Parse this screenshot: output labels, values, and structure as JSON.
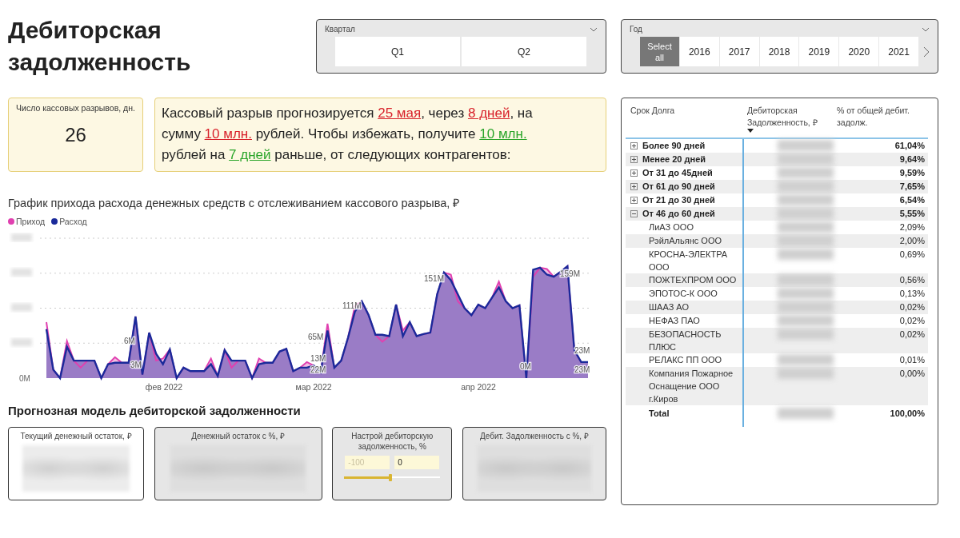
{
  "title": "Дебиторская задолженность",
  "quarter_slicer": {
    "label": "Квартал",
    "items": [
      {
        "label": "Q1",
        "selected": false
      },
      {
        "label": "Q2",
        "selected": false
      }
    ]
  },
  "year_slicer": {
    "label": "Год",
    "items": [
      {
        "label": "Select all",
        "selected": true
      },
      {
        "label": "2016",
        "selected": false
      },
      {
        "label": "2017",
        "selected": false
      },
      {
        "label": "2018",
        "selected": false
      },
      {
        "label": "2019",
        "selected": false
      },
      {
        "label": "2020",
        "selected": false
      },
      {
        "label": "2021",
        "selected": false
      }
    ]
  },
  "kpi": {
    "label": "Число кассовых разрывов, дн.",
    "value": "26"
  },
  "message": [
    {
      "text": "Кассовый разрыв прогнозируется ",
      "kind": "plain"
    },
    {
      "text": "25 мая",
      "kind": "alert"
    },
    {
      "text": ", через ",
      "kind": "plain"
    },
    {
      "text": "8 дней",
      "kind": "alert"
    },
    {
      "text": ", на сумму ",
      "kind": "plain"
    },
    {
      "text": "10 млн.",
      "kind": "alert"
    },
    {
      "text": "  рублей. Чтобы избежать, получите ",
      "kind": "plain"
    },
    {
      "text": "10 млн.",
      "kind": "good"
    },
    {
      "text": " рублей на ",
      "kind": "plain"
    },
    {
      "text": "7 дней",
      "kind": "good"
    },
    {
      "text": " раньше, от следующих контрагентов:",
      "kind": "plain"
    }
  ],
  "chart": {
    "title": "График прихода расхода денежных средств с отслеживанием кассового разрыва, ₽",
    "legend": [
      {
        "name": "Приход",
        "color": "#e040b0"
      },
      {
        "name": "Расход",
        "color": "#1a2a9a"
      }
    ],
    "y_axis_label": "0M",
    "months": [
      "фев 2022",
      "мар 2022",
      "апр 2022"
    ],
    "value_labels": [
      "6M",
      "3M",
      "65M",
      "13M",
      "22M",
      "111M",
      "151M",
      "0M",
      "159M",
      "23M",
      "23M"
    ]
  },
  "model": {
    "title": "Прогнозная модель дебиторской задолженности",
    "cards": [
      {
        "kind": "value",
        "label": "Текущий денежный остаток, ₽",
        "shaded": false
      },
      {
        "kind": "value",
        "label": "Денежный остаток с %, ₽",
        "shaded": true
      },
      {
        "kind": "slider",
        "label": "Настрой дебиторскую задолженность, %",
        "min": "-100",
        "value": "0",
        "level": 0.48,
        "shaded": true
      },
      {
        "kind": "value",
        "label": "Дебит. Задолженность с %, ₽",
        "shaded": true
      }
    ]
  },
  "table": {
    "columns": [
      "Срок Долга",
      "Дебиторская Задолженность, ₽",
      "% от общей дебит. задолж."
    ],
    "rows": [
      {
        "name": "Более 90 дней",
        "pct": "61,04%",
        "expanded": false
      },
      {
        "name": "Менее 20 дней",
        "pct": "9,64%",
        "expanded": false
      },
      {
        "name": "От 31 до 45дней",
        "pct": "9,59%",
        "expanded": false
      },
      {
        "name": "От 61 до 90 дней",
        "pct": "7,65%",
        "expanded": false
      },
      {
        "name": "От 21 до 30 дней",
        "pct": "6,54%",
        "expanded": false
      },
      {
        "name": "От 46 до 60 дней",
        "pct": "5,55%",
        "expanded": true,
        "children": [
          {
            "name": "ЛиАЗ ООО",
            "pct": "2,09%"
          },
          {
            "name": "РэйлАльянс ООО",
            "pct": "2,00%"
          },
          {
            "name": "КРОСНА-ЭЛЕКТРА ООО",
            "pct": "0,69%"
          },
          {
            "name": "ПОЖТЕХПРОМ ООО",
            "pct": "0,56%"
          },
          {
            "name": "ЭПОТОС-К ООО",
            "pct": "0,13%"
          },
          {
            "name": "ШААЗ АО",
            "pct": "0,02%"
          },
          {
            "name": "НЕФАЗ ПАО",
            "pct": "0,02%"
          },
          {
            "name": "БЕЗОПАСНОСТЬ ПЛЮС",
            "pct": "0,02%"
          },
          {
            "name": "РЕЛАКС ПП ООО",
            "pct": "0,01%"
          },
          {
            "name": "Компания Пожарное Оснащение ООО г.Киров",
            "pct": "0,00%"
          }
        ]
      }
    ],
    "total": {
      "name": "Total",
      "pct": "100,00%"
    }
  }
}
